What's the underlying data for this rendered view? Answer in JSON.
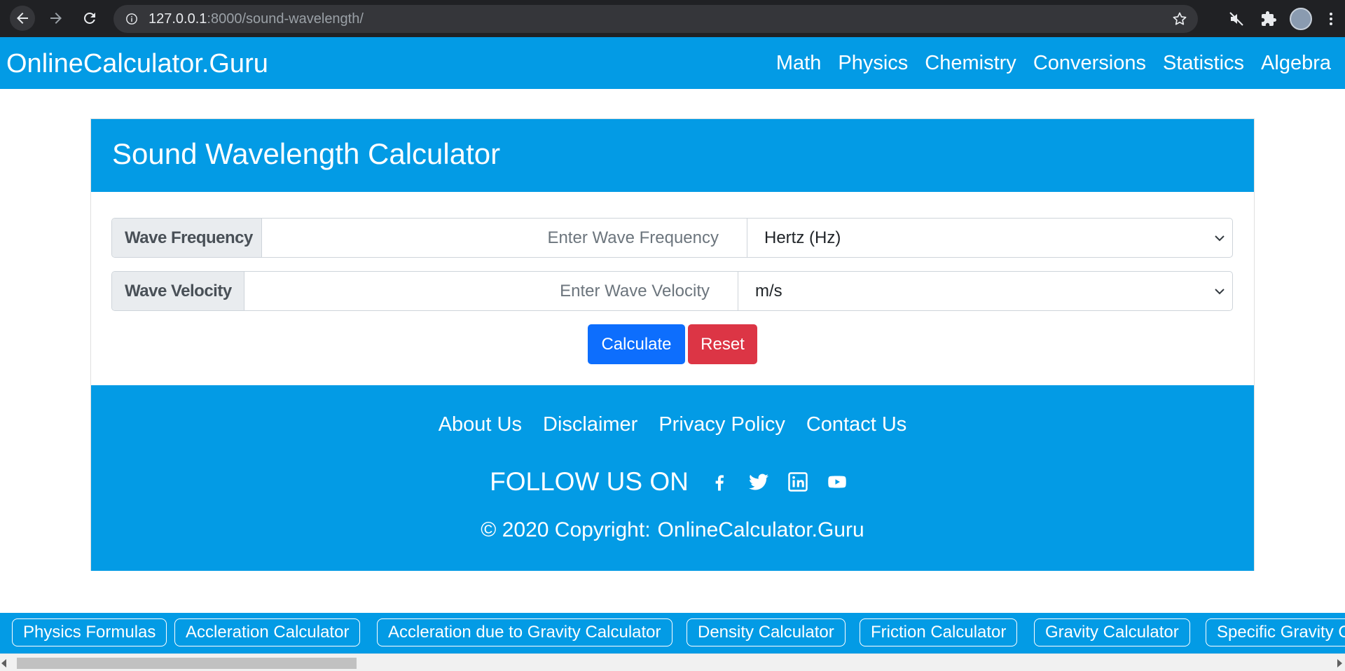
{
  "browser": {
    "url_host": "127.0.0.1",
    "url_rest": ":8000/sound-wavelength/"
  },
  "header": {
    "brand": "OnlineCalculator.Guru",
    "nav": [
      "Math",
      "Physics",
      "Chemistry",
      "Conversions",
      "Statistics",
      "Algebra"
    ]
  },
  "calculator": {
    "title": "Sound Wavelength Calculator",
    "fields": [
      {
        "label": "Wave Frequency",
        "placeholder": "Enter Wave Frequency",
        "unit": "Hertz (Hz)"
      },
      {
        "label": "Wave Velocity",
        "placeholder": "Enter Wave Velocity",
        "unit": "m/s"
      }
    ],
    "calculate_label": "Calculate",
    "reset_label": "Reset"
  },
  "footer": {
    "links": [
      "About Us",
      "Disclaimer",
      "Privacy Policy",
      "Contact Us"
    ],
    "follow_text": "FOLLOW US ON",
    "social_icons": [
      "facebook-icon",
      "twitter-icon",
      "linkedin-icon",
      "youtube-icon"
    ],
    "copyright_text": "© 2020 Copyright:",
    "copyright_brand": "OnlineCalculator.Guru"
  },
  "bottom_links": [
    "Physics Formulas",
    "Accleration Calculator",
    "Accleration due to Gravity Calculator",
    "Density Calculator",
    "Friction Calculator",
    "Gravity Calculator",
    "Specific Gravity Calculator"
  ],
  "colors": {
    "primary": "#039be5",
    "calculate": "#0d6efd",
    "reset": "#dc3545"
  }
}
